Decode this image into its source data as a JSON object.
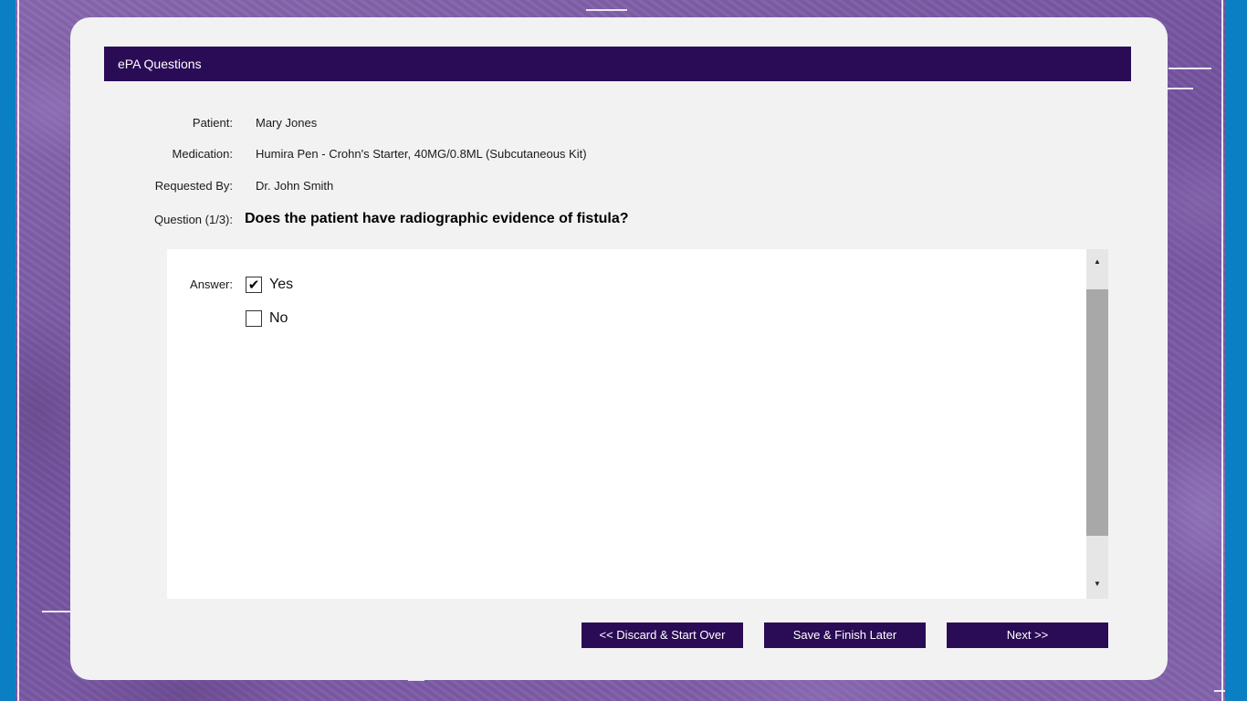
{
  "header": {
    "title": "ePA Questions"
  },
  "info": {
    "patient_label": "Patient:",
    "patient_value": "Mary Jones",
    "medication_label": "Medication:",
    "medication_value": "Humira Pen - Crohn's Starter, 40MG/0.8ML (Subcutaneous Kit)",
    "requested_by_label": "Requested By:",
    "requested_by_value": "Dr. John Smith",
    "question_label": "Question (1/3):",
    "question_value": "Does the patient have radiographic evidence of fistula?"
  },
  "answer": {
    "label": "Answer:",
    "options": [
      {
        "label": "Yes",
        "checked": true
      },
      {
        "label": "No",
        "checked": false
      }
    ]
  },
  "buttons": {
    "discard": "<< Discard & Start Over",
    "save": "Save & Finish Later",
    "next": "Next >>"
  },
  "icons": {
    "checkmark": "check-icon",
    "scroll_up": "triangle-up-icon",
    "scroll_down": "triangle-down-icon"
  },
  "colors": {
    "primary": "#2a0b55",
    "background": "#7a5aa0",
    "edge": "#0a7fc4"
  }
}
